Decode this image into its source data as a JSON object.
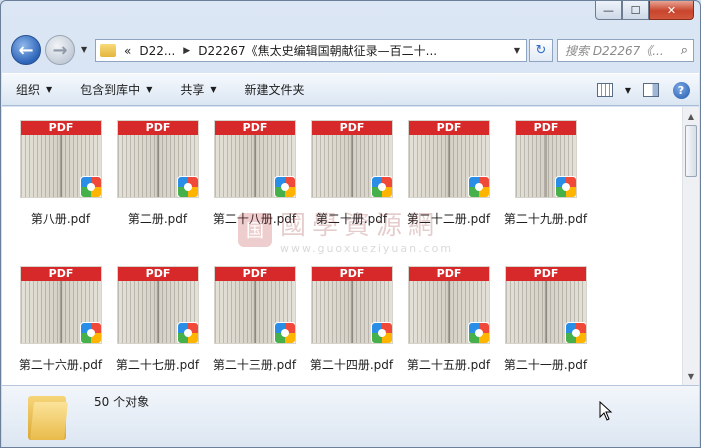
{
  "window": {
    "caption": {
      "minimize": "—",
      "maximize": "☐",
      "close": "✕"
    }
  },
  "nav": {
    "back": "←",
    "forward": "→",
    "breadcrumbs": [
      "«",
      "D22...",
      "D22267《焦太史编辑国朝献征录—百二十..."
    ],
    "search_placeholder": "搜索 D22267《...",
    "refresh": "↻"
  },
  "toolbar": {
    "organize": "组织",
    "include_library": "包含到库中",
    "share": "共享",
    "new_folder": "新建文件夹"
  },
  "files": [
    {
      "name": "第八册.pdf",
      "label": "PDF"
    },
    {
      "name": "第二册.pdf",
      "label": "PDF"
    },
    {
      "name": "第二十八册.pdf",
      "label": "PDF"
    },
    {
      "name": "第二十册.pdf",
      "label": "PDF"
    },
    {
      "name": "第二十二册.pdf",
      "label": "PDF"
    },
    {
      "name": "第二十九册.pdf",
      "label": "PDF"
    },
    {
      "name": "第二十六册.pdf",
      "label": "PDF"
    },
    {
      "name": "第二十七册.pdf",
      "label": "PDF"
    },
    {
      "name": "第二十三册.pdf",
      "label": "PDF"
    },
    {
      "name": "第二十四册.pdf",
      "label": "PDF"
    },
    {
      "name": "第二十五册.pdf",
      "label": "PDF"
    },
    {
      "name": "第二十一册.pdf",
      "label": "PDF"
    }
  ],
  "watermark": {
    "seal": "国",
    "text": "國學資源網",
    "url": "www.guoxueziyuan.com"
  },
  "status": {
    "count": "50 个对象"
  },
  "colors": {
    "pdf_band": "#d7282a",
    "window": "#dce7f5"
  }
}
